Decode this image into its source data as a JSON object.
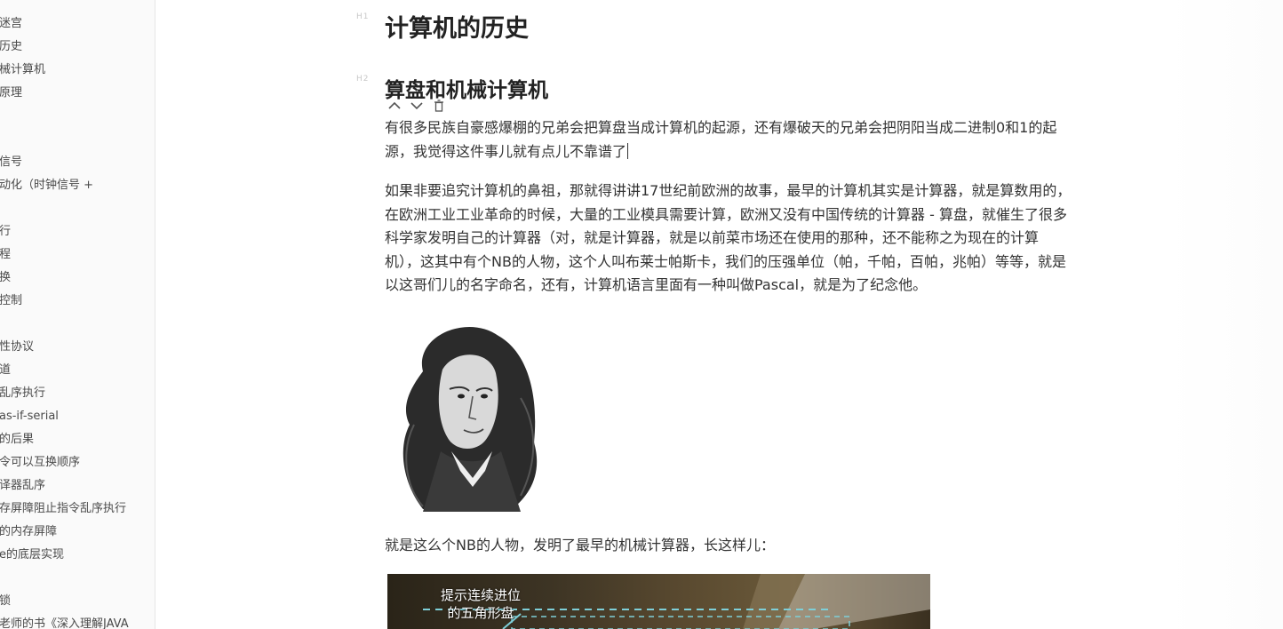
{
  "sidebar": {
    "items": [
      {
        "label": "迷宫"
      },
      {
        "label": "历史"
      },
      {
        "label": "械计算机"
      },
      {
        "label": "原理"
      },
      {
        "label": "信号"
      },
      {
        "label": "动化（时钟信号 +"
      },
      {
        "label": "行"
      },
      {
        "label": "程"
      },
      {
        "label": "换"
      },
      {
        "label": "控制"
      },
      {
        "label": "性协议"
      },
      {
        "label": "道"
      },
      {
        "label": "乱序执行"
      },
      {
        "label": "as-if-serial"
      },
      {
        "label": "的后果"
      },
      {
        "label": "令可以互换顺序"
      },
      {
        "label": "译器乱序"
      },
      {
        "label": "存屏障阻止指令乱序执行"
      },
      {
        "label": "的内存屏障"
      },
      {
        "label": "e的底层实现"
      },
      {
        "label": "锁"
      },
      {
        "label": "老师的书《深入理解JAVA"
      }
    ]
  },
  "document": {
    "h1_marker": "H1",
    "h2_marker": "H2",
    "title": "计算机的历史",
    "section_title": "算盘和机械计算机",
    "para1": {
      "lines": [
        "有很多民族自豪感爆棚的兄弟会把算盘当成计算机的起源，还有爆破天的兄弟会把阴阳当成二进制0和1的起",
        "源，我觉得这件事儿就有点儿不靠谱了"
      ]
    },
    "para2": {
      "lines": [
        "如果非要追究计算机的鼻祖，那就得讲讲17世纪前欧洲的故事，最早的计算机其实是计算器，就是算数用的，",
        "在欧洲工业工业革命的时候，大量的工业模具需要计算，欧洲又没有中国传统的计算器 - 算盘，就催生了很多",
        "科学家发明自己的计算器（对，就是计算器，就是以前菜市场还在使用的那种，还不能称之为现在的计算",
        "机），这其中有个NB的人物，这个人叫布莱士帕斯卡，我们的压强单位（帕，千帕，百帕，兆帕）等等，就是",
        "以这哥们儿的名字命名，还有，计算机语言里面有一种叫做Pascal，就是为了纪念他。"
      ]
    },
    "para3": "就是这么个NB的人物，发明了最早的机械计算器，长这样儿：",
    "image_caption_line1": "提示连续进位",
    "image_caption_line2": "的五角形盘"
  },
  "icons": {
    "move_up": "chevron-up-icon",
    "move_down": "chevron-down-icon",
    "delete": "trash-icon"
  }
}
